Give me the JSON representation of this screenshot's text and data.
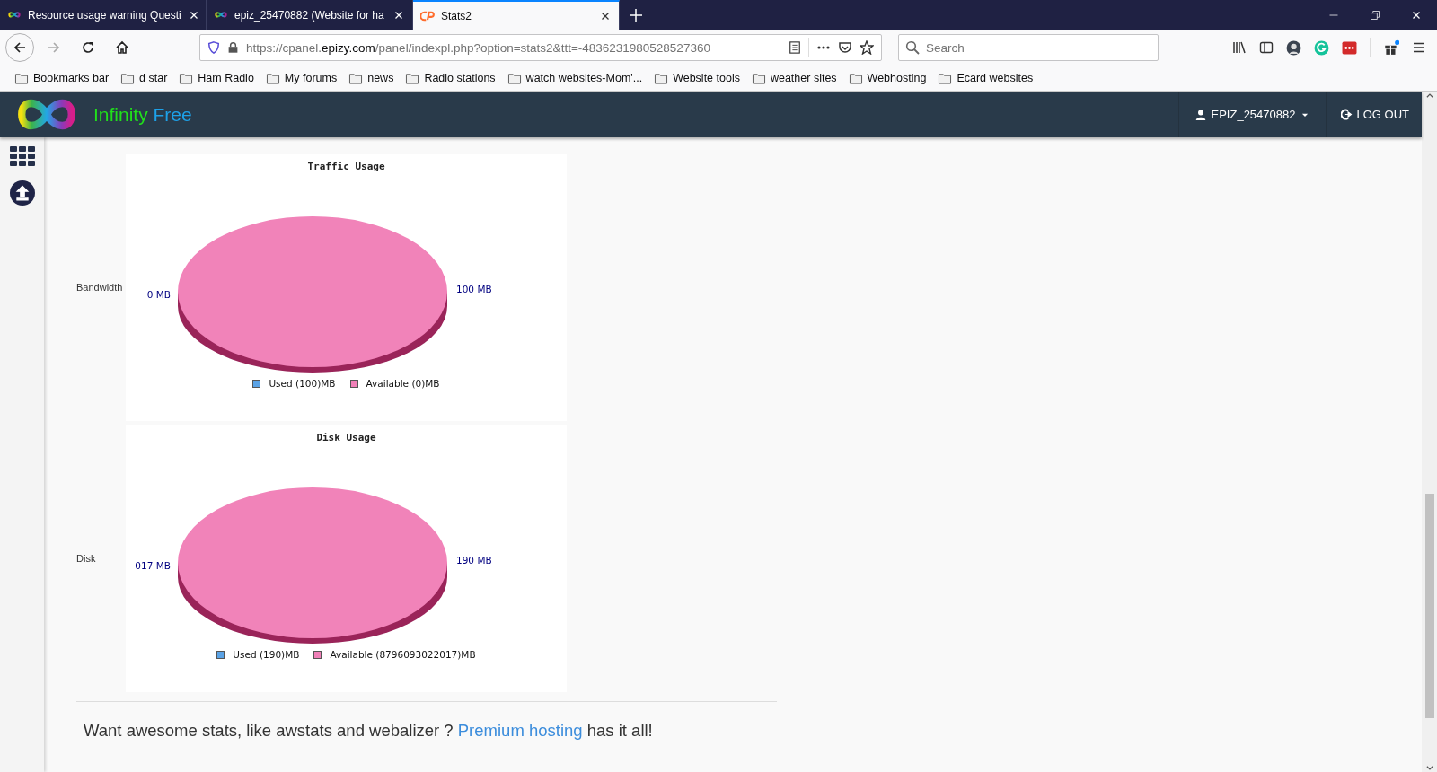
{
  "browser": {
    "tabs": [
      {
        "title": "Resource usage warning Questi",
        "kind": "infinity",
        "selected": false
      },
      {
        "title": "epiz_25470882 (Website for ha",
        "kind": "infinity",
        "selected": false
      },
      {
        "title": "Stats2",
        "kind": "cpanel",
        "selected": true
      }
    ],
    "address": "https://cpanel.**epizy.com**/panel/indexpl.php?option=stats2&ttt=-4836231980528527360",
    "search": {
      "placeholder": "Search"
    },
    "bookmarks": [
      "Bookmarks bar",
      "d star",
      "Ham Radio",
      "My forums",
      "news",
      "Radio stations",
      "watch websites-Mom'...",
      "Website tools",
      "weather sites",
      "Webhosting",
      "Ecard websites"
    ]
  },
  "header": {
    "brand_first": "Infinity",
    "brand_second": "Free",
    "user": "EPIZ_25470882",
    "logout": "LOG OUT"
  },
  "charts": [
    {
      "title": "Traffic Usage",
      "row_label": "Bandwidth",
      "left_label": "0 MB",
      "right_label": "100 MB",
      "legend": [
        {
          "label": "Used (100)MB",
          "color": "#5ba3e6"
        },
        {
          "label": "Available (0)MB",
          "color": "#f080b8"
        }
      ]
    },
    {
      "title": "Disk Usage",
      "row_label": "Disk",
      "left_label": "017 MB",
      "right_label": "190 MB",
      "legend": [
        {
          "label": "Used (190)MB",
          "color": "#5ba3e6"
        },
        {
          "label": "Available (8796093022017)MB",
          "color": "#f080b8"
        }
      ]
    }
  ],
  "footer": {
    "text": "Want awesome stats, like awstats and webalizer ?",
    "link": "Premium hosting",
    "after": "has it all!"
  }
}
